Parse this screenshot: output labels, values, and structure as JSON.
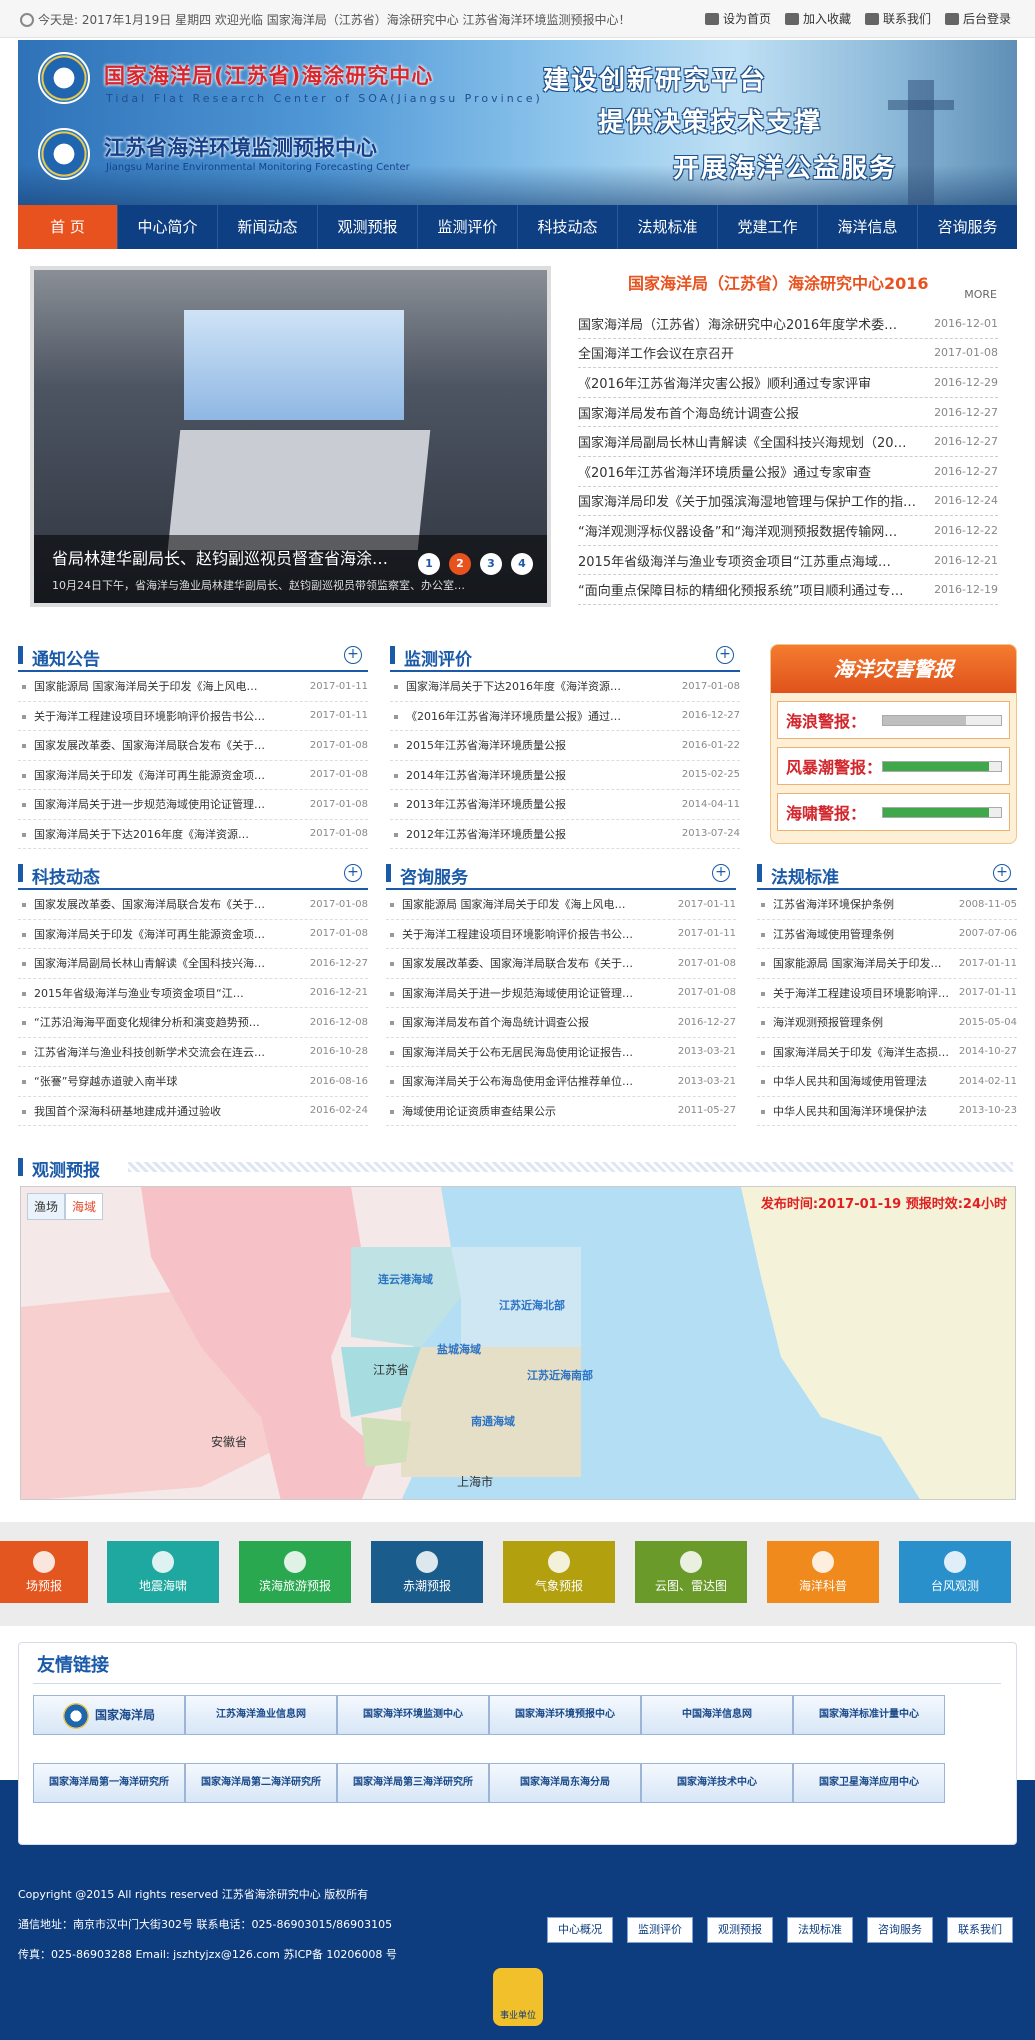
{
  "topbar": {
    "welcome": "今天是: 2017年1月19日 星期四 欢迎光临 国家海洋局（江苏省）海涂研究中心 江苏省海洋环境监测预报中心！",
    "links": [
      "设为首页",
      "加入收藏",
      "联系我们",
      "后台登录"
    ]
  },
  "banner": {
    "title1": "国家海洋局(江苏省)海涂研究中心",
    "title1_en": "Tidal Flat Research Center of SOA(Jiangsu Province)",
    "title2": "江苏省海洋环境监测预报中心",
    "title2_en": "Jiangsu Marine Environmental Monitoring Forecasting Center",
    "slogans": [
      "建设创新研究平台",
      "提供决策技术支撑",
      "开展海洋公益服务"
    ]
  },
  "nav": [
    "首 页",
    "中心简介",
    "新闻动态",
    "观测预报",
    "监测评价",
    "科技动态",
    "法规标准",
    "党建工作",
    "海洋信息",
    "咨询服务"
  ],
  "slide": {
    "caption": "省局林建华副局长、赵钧副巡视员督查省海涂…",
    "sub": "10月24日下午，省海洋与渔业局林建华副局长、赵钧副巡视员带领监察室、办公室…",
    "dots": [
      "1",
      "2",
      "3",
      "4"
    ]
  },
  "news": {
    "title": "国家海洋局（江苏省）海涂研究中心2016",
    "more": "MORE",
    "items": [
      {
        "t": "国家海洋局（江苏省）海涂研究中心2016年度学术委…",
        "d": "2016-12-01"
      },
      {
        "t": "全国海洋工作会议在京召开",
        "d": "2017-01-08"
      },
      {
        "t": "《2016年江苏省海洋灾害公报》顺利通过专家评审",
        "d": "2016-12-29"
      },
      {
        "t": "国家海洋局发布首个海岛统计调查公报",
        "d": "2016-12-27"
      },
      {
        "t": "国家海洋局副局长林山青解读《全国科技兴海规划（20…",
        "d": "2016-12-27"
      },
      {
        "t": "《2016年江苏省海洋环境质量公报》通过专家审查",
        "d": "2016-12-27"
      },
      {
        "t": "国家海洋局印发《关于加强滨海湿地管理与保护工作的指…",
        "d": "2016-12-24"
      },
      {
        "t": "“海洋观测浮标仪器设备”和“海洋观测预报数据传输网…",
        "d": "2016-12-22"
      },
      {
        "t": "2015年省级海洋与渔业专项资金项目“江苏重点海域…",
        "d": "2016-12-21"
      },
      {
        "t": "“面向重点保障目标的精细化预报系统”项目顺利通过专…",
        "d": "2016-12-19"
      }
    ]
  },
  "notice": {
    "title": "通知公告",
    "items": [
      {
        "t": "国家能源局 国家海洋局关于印发《海上风电…",
        "d": "2017-01-11"
      },
      {
        "t": "关于海洋工程建设项目环境影响评价报告书公…",
        "d": "2017-01-11"
      },
      {
        "t": "国家发展改革委、国家海洋局联合发布《关于…",
        "d": "2017-01-08"
      },
      {
        "t": "国家海洋局关于印发《海洋可再生能源资金项…",
        "d": "2017-01-08"
      },
      {
        "t": "国家海洋局关于进一步规范海域使用论证管理…",
        "d": "2017-01-08"
      },
      {
        "t": "国家海洋局关于下达2016年度《海洋资源…",
        "d": "2017-01-08"
      }
    ]
  },
  "monitor": {
    "title": "监测评价",
    "items": [
      {
        "t": "国家海洋局关于下达2016年度《海洋资源…",
        "d": "2017-01-08"
      },
      {
        "t": "《2016年江苏省海洋环境质量公报》通过…",
        "d": "2016-12-27"
      },
      {
        "t": "2015年江苏省海洋环境质量公报",
        "d": "2016-01-22"
      },
      {
        "t": "2014年江苏省海洋环境质量公报",
        "d": "2015-02-25"
      },
      {
        "t": "2013年江苏省海洋环境质量公报",
        "d": "2014-04-11"
      },
      {
        "t": "2012年江苏省海洋环境质量公报",
        "d": "2013-07-24"
      }
    ]
  },
  "alert": {
    "title": "海洋灾害警报",
    "items": [
      {
        "label": "海浪警报：",
        "level": 0.7,
        "color": "#bfbfbf"
      },
      {
        "label": "风暴潮警报：",
        "level": 0.9,
        "color": "#3fa84a"
      },
      {
        "label": "海啸警报：",
        "level": 0.9,
        "color": "#3fa84a"
      }
    ]
  },
  "tech": {
    "title": "科技动态",
    "items": [
      {
        "t": "国家发展改革委、国家海洋局联合发布《关于…",
        "d": "2017-01-08"
      },
      {
        "t": "国家海洋局关于印发《海洋可再生能源资金项…",
        "d": "2017-01-08"
      },
      {
        "t": "国家海洋局副局长林山青解读《全国科技兴海…",
        "d": "2016-12-27"
      },
      {
        "t": "2015年省级海洋与渔业专项资金项目“江…",
        "d": "2016-12-21"
      },
      {
        "t": "“江苏沿海海平面变化规律分析和演变趋势预…",
        "d": "2016-12-08"
      },
      {
        "t": "江苏省海洋与渔业科技创新学术交流会在连云…",
        "d": "2016-10-28"
      },
      {
        "t": "“张謇”号穿越赤道驶入南半球",
        "d": "2016-08-16"
      },
      {
        "t": "我国首个深海科研基地建成并通过验收",
        "d": "2016-02-24"
      }
    ]
  },
  "consult": {
    "title": "咨询服务",
    "items": [
      {
        "t": "国家能源局 国家海洋局关于印发《海上风电…",
        "d": "2017-01-11"
      },
      {
        "t": "关于海洋工程建设项目环境影响评价报告书公…",
        "d": "2017-01-11"
      },
      {
        "t": "国家发展改革委、国家海洋局联合发布《关于…",
        "d": "2017-01-08"
      },
      {
        "t": "国家海洋局关于进一步规范海域使用论证管理…",
        "d": "2017-01-08"
      },
      {
        "t": "国家海洋局发布首个海岛统计调查公报",
        "d": "2016-12-27"
      },
      {
        "t": "国家海洋局关于公布无居民海岛使用论证报告…",
        "d": "2013-03-21"
      },
      {
        "t": "国家海洋局关于公布海岛使用金评估推荐单位…",
        "d": "2013-03-21"
      },
      {
        "t": "海域使用论证资质审查结果公示",
        "d": "2011-05-27"
      }
    ]
  },
  "law": {
    "title": "法规标准",
    "items": [
      {
        "t": "江苏省海洋环境保护条例",
        "d": "2008-11-05"
      },
      {
        "t": "江苏省海域使用管理条例",
        "d": "2007-07-06"
      },
      {
        "t": "国家能源局 国家海洋局关于印发…",
        "d": "2017-01-11"
      },
      {
        "t": "关于海洋工程建设项目环境影响评…",
        "d": "2017-01-11"
      },
      {
        "t": "海洋观测预报管理条例",
        "d": "2015-05-04"
      },
      {
        "t": "国家海洋局关于印发《海洋生态损…",
        "d": "2014-10-27"
      },
      {
        "t": "中华人民共和国海域使用管理法",
        "d": "2014-02-11"
      },
      {
        "t": "中华人民共和国海洋环境保护法",
        "d": "2013-10-23"
      }
    ]
  },
  "obs": {
    "title": "观测预报",
    "tabs": [
      "渔场",
      "海域"
    ],
    "publish": "发布时间:2017-01-19 预报时效:24小时",
    "labels": {
      "lyg": "连云港海域",
      "jsnb": "江苏近海北部",
      "yc": "盐城海域",
      "jsnan": "江苏近海南部",
      "nt": "南通海域",
      "js": "江苏省",
      "ah": "安徽省",
      "sh": "上海市"
    }
  },
  "tiles": [
    {
      "label": "场预报",
      "color": "#e4561f"
    },
    {
      "label": "地震海啸",
      "color": "#1fa8a0"
    },
    {
      "label": "滨海旅游预报",
      "color": "#2aa84f"
    },
    {
      "label": "赤潮预报",
      "color": "#1a5c8c"
    },
    {
      "label": "气象预报",
      "color": "#b2a00e"
    },
    {
      "label": "云图、雷达图",
      "color": "#6a9a2a"
    },
    {
      "label": "海洋科普",
      "color": "#f08a1c"
    },
    {
      "label": "台风观测",
      "color": "#2990cc"
    }
  ],
  "friend": {
    "title": "友情链接",
    "links": [
      "国家海洋局",
      "江苏海洋渔业信息网",
      "国家海洋环境监测中心",
      "国家海洋环境预报中心",
      "中国海洋信息网",
      "国家海洋标准计量中心",
      "国家海洋局第一海洋研究所",
      "国家海洋局第二海洋研究所",
      "国家海洋局第三海洋研究所",
      "国家海洋局东海分局",
      "国家海洋技术中心",
      "国家卫星海洋应用中心"
    ]
  },
  "footer": {
    "l1": "Copyright @2015 All rights reserved    江苏省海涂研究中心    版权所有",
    "l2": "通信地址：南京市汉中门大街302号    联系电话：025-86903015/86903105",
    "l3": "传真：025-86903288    Email: jszhtyjzx@126.com    苏ICP备 10206008 号",
    "btns": [
      "中心概况",
      "监测评价",
      "观测预报",
      "法规标准",
      "咨询服务",
      "联系我们"
    ],
    "badge": "事业单位"
  }
}
